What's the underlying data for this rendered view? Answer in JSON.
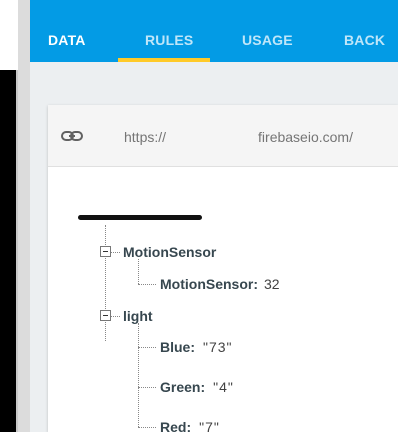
{
  "tabs": [
    {
      "label": "DATA",
      "active": true
    },
    {
      "label": "RULES",
      "active": false
    },
    {
      "label": "USAGE",
      "active": false
    },
    {
      "label": "BACK",
      "active": false
    }
  ],
  "colors": {
    "header": "#039be5",
    "indicator": "#ffca28",
    "content_bg": "#eceff1"
  },
  "url_bar": {
    "icon": "link-icon",
    "prefix": "https://",
    "suffix": "firebaseio.com/"
  },
  "tree": {
    "motion_sensor": {
      "label": "MotionSensor",
      "child": {
        "key": "MotionSensor:",
        "value": "32"
      }
    },
    "light": {
      "label": "light",
      "children": [
        {
          "key": "Blue:",
          "value": "\"73\""
        },
        {
          "key": "Green:",
          "value": "\"4\""
        },
        {
          "key": "Red:",
          "value": "\"7\""
        }
      ]
    }
  }
}
